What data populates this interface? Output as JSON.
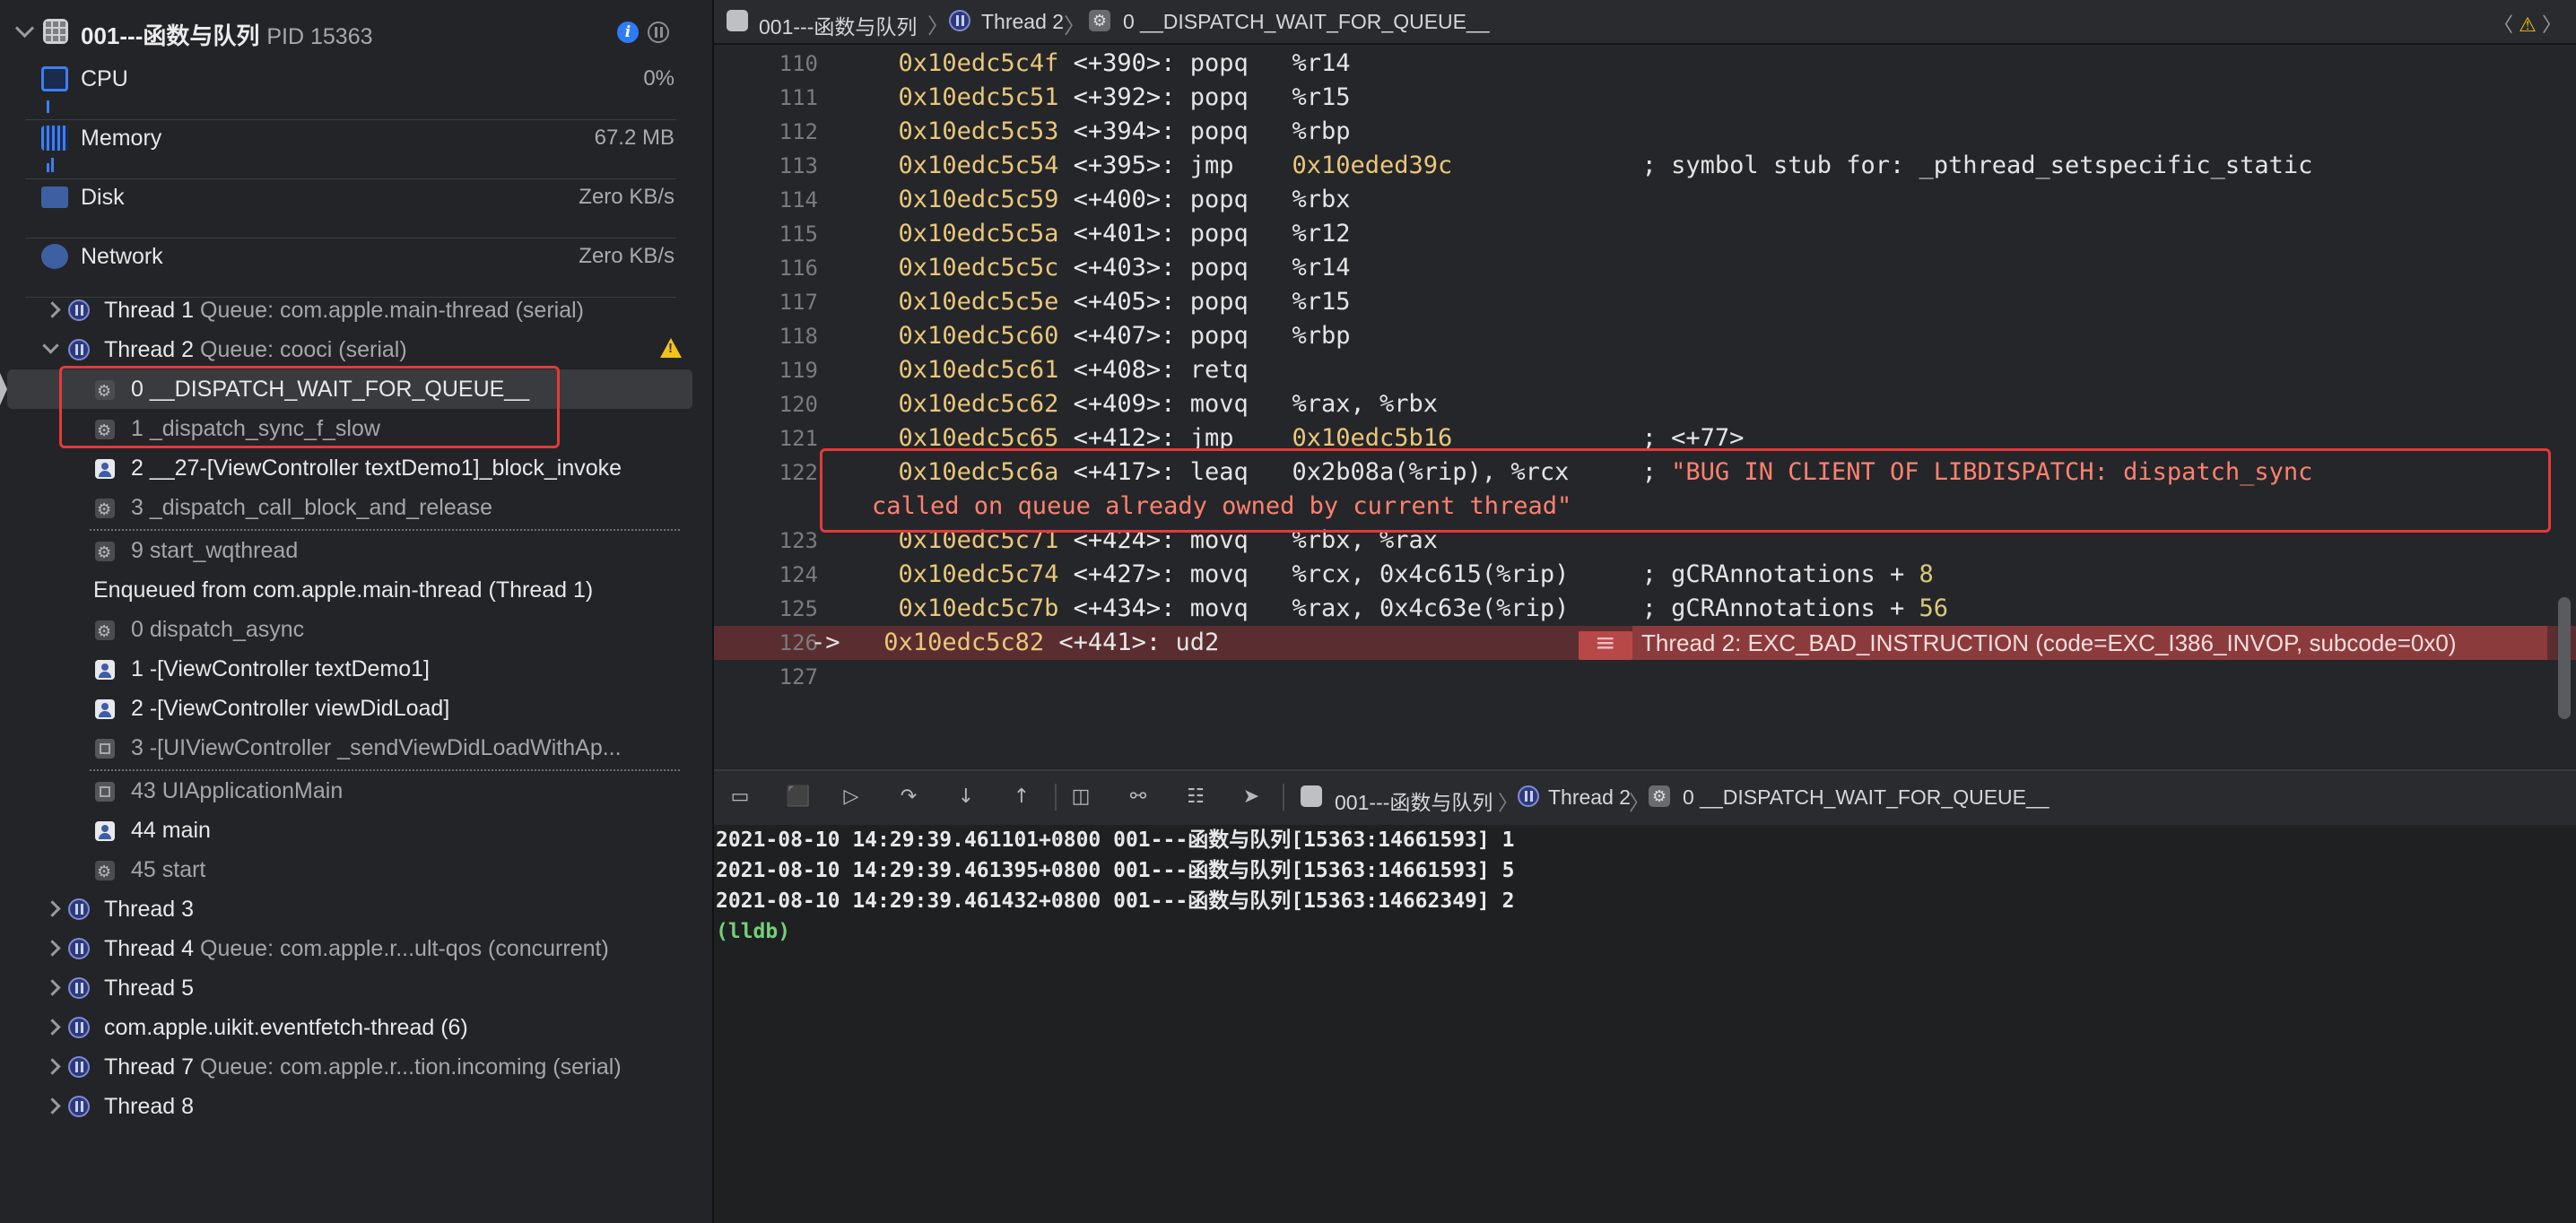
{
  "process": {
    "name": "001---函数与队列",
    "pid": "PID 15363"
  },
  "gauges": [
    {
      "name": "CPU",
      "value": "0%"
    },
    {
      "name": "Memory",
      "value": "67.2 MB"
    },
    {
      "name": "Disk",
      "value": "Zero KB/s"
    },
    {
      "name": "Network",
      "value": "Zero KB/s"
    }
  ],
  "threads": {
    "t1": {
      "name": "Thread 1",
      "queue": "Queue: com.apple.main-thread (serial)"
    },
    "t2": {
      "name": "Thread 2",
      "queue": "Queue: cooci (serial)"
    },
    "frames": [
      "0 __DISPATCH_WAIT_FOR_QUEUE__",
      "1 _dispatch_sync_f_slow",
      "2 __27-[ViewController textDemo1]_block_invoke",
      "3 _dispatch_call_block_and_release",
      "9 start_wqthread"
    ],
    "enqueued": "Enqueued from com.apple.main-thread (Thread 1)",
    "enq_frames": [
      "0 dispatch_async",
      "1 -[ViewController textDemo1]",
      "2 -[ViewController viewDidLoad]",
      "3 -[UIViewController _sendViewDidLoadWithAp...",
      "43 UIApplicationMain",
      "44 main",
      "45 start"
    ],
    "t3": {
      "name": "Thread 3"
    },
    "t4": {
      "name": "Thread 4",
      "queue": "Queue: com.apple.r...ult-qos (concurrent)"
    },
    "t5": {
      "name": "Thread 5"
    },
    "t6": {
      "name": "com.apple.uikit.eventfetch-thread (6)"
    },
    "t7": {
      "name": "Thread 7",
      "queue": "Queue: com.apple.r...tion.incoming (serial)"
    },
    "t8": {
      "name": "Thread 8"
    }
  },
  "jumpbar": {
    "project": "001---函数与队列",
    "thread": "Thread 2",
    "frame": "0 __DISPATCH_WAIT_FOR_QUEUE__"
  },
  "code": [
    {
      "n": "110",
      "addr": "0x10edc5c4f",
      "off": "<+390>:",
      "op": "popq",
      "args": "%r14"
    },
    {
      "n": "111",
      "addr": "0x10edc5c51",
      "off": "<+392>:",
      "op": "popq",
      "args": "%r15"
    },
    {
      "n": "112",
      "addr": "0x10edc5c53",
      "off": "<+394>:",
      "op": "popq",
      "args": "%rbp"
    },
    {
      "n": "113",
      "addr": "0x10edc5c54",
      "off": "<+395>:",
      "op": "jmp",
      "args": "0x10eded39c",
      "comment": "; symbol stub for: _pthread_setspecific_static"
    },
    {
      "n": "114",
      "addr": "0x10edc5c59",
      "off": "<+400>:",
      "op": "popq",
      "args": "%rbx"
    },
    {
      "n": "115",
      "addr": "0x10edc5c5a",
      "off": "<+401>:",
      "op": "popq",
      "args": "%r12"
    },
    {
      "n": "116",
      "addr": "0x10edc5c5c",
      "off": "<+403>:",
      "op": "popq",
      "args": "%r14"
    },
    {
      "n": "117",
      "addr": "0x10edc5c5e",
      "off": "<+405>:",
      "op": "popq",
      "args": "%r15"
    },
    {
      "n": "118",
      "addr": "0x10edc5c60",
      "off": "<+407>:",
      "op": "popq",
      "args": "%rbp"
    },
    {
      "n": "119",
      "addr": "0x10edc5c61",
      "off": "<+408>:",
      "op": "retq",
      "args": ""
    },
    {
      "n": "120",
      "addr": "0x10edc5c62",
      "off": "<+409>:",
      "op": "movq",
      "args": "%rax, %rbx"
    },
    {
      "n": "121",
      "addr": "0x10edc5c65",
      "off": "<+412>:",
      "op": "jmp",
      "args": "0x10edc5b16",
      "comment": "; <+77>"
    },
    {
      "n": "122",
      "addr": "0x10edc5c6a",
      "off": "<+417>:",
      "op": "leaq",
      "args": "0x2b08a(%rip), %rcx",
      "comment": "; ",
      "str": "\"BUG IN CLIENT OF LIBDISPATCH: dispatch_sync",
      "str2": "called on queue already owned by current thread\""
    },
    {
      "n": "123",
      "addr": "0x10edc5c71",
      "off": "<+424>:",
      "op": "movq",
      "args": "%rbx, %rax"
    },
    {
      "n": "124",
      "addr": "0x10edc5c74",
      "off": "<+427>:",
      "op": "movq",
      "args": "%rcx, 0x4c615(%rip)",
      "comment": "; gCRAnnotations + ",
      "num": "8"
    },
    {
      "n": "125",
      "addr": "0x10edc5c7b",
      "off": "<+434>:",
      "op": "movq",
      "args": "%rax, 0x4c63e(%rip)",
      "comment": "; gCRAnnotations + ",
      "num": "56"
    },
    {
      "n": "126",
      "arrow": "->",
      "addr": "0x10edc5c82",
      "off": "<+441>:",
      "op": "ud2",
      "args": ""
    },
    {
      "n": "127"
    }
  ],
  "error": "Thread 2: EXC_BAD_INSTRUCTION (code=EXC_I386_INVOP, subcode=0x0)",
  "debugbar": {
    "project": "001---函数与队列",
    "thread": "Thread 2",
    "frame": "0 __DISPATCH_WAIT_FOR_QUEUE__"
  },
  "console": [
    "2021-08-10 14:29:39.461101+0800 001---函数与队列[15363:14661593] 1",
    "2021-08-10 14:29:39.461395+0800 001---函数与队列[15363:14661593] 5",
    "2021-08-10 14:29:39.461432+0800 001---函数与队列[15363:14662349] 2"
  ],
  "prompt": "(lldb)"
}
